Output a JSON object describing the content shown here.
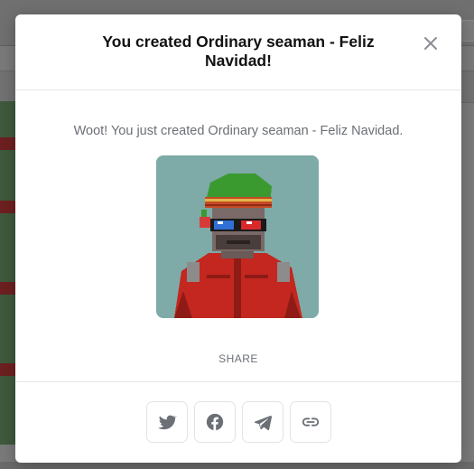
{
  "modal": {
    "title": "You created Ordinary seaman - Feliz Navidad!",
    "message": "Woot! You just created Ordinary seaman - Feliz Navidad.",
    "share_label": "SHARE",
    "share_buttons": [
      {
        "icon": "twitter-icon"
      },
      {
        "icon": "facebook-icon"
      },
      {
        "icon": "telegram-icon"
      },
      {
        "icon": "link-icon"
      }
    ]
  },
  "colors": {
    "image_background": "#7eaaa7",
    "icon_gray": "#6b6f76",
    "title": "#121212"
  }
}
